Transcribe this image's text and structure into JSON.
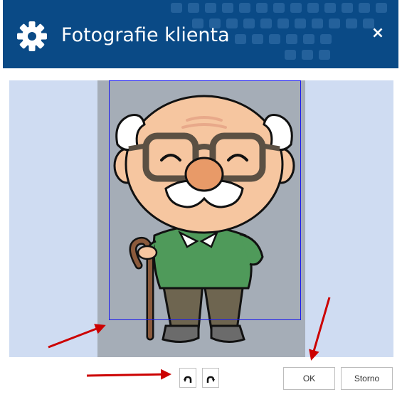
{
  "dialog": {
    "title": "Fotografie klienta",
    "close_label": "×",
    "header_icon": "gear-icon",
    "header_color": "#0a4a86"
  },
  "editor": {
    "background_color": "#cfdcf2",
    "photo_background": "#a5adb7",
    "crop_frame_color": "#1a1aee",
    "photo_subject": "cartoon-grandfather-with-cane"
  },
  "toolbar": {
    "rotate_left_icon": "rotate-left-icon",
    "rotate_right_icon": "rotate-right-icon"
  },
  "buttons": {
    "ok_label": "OK",
    "cancel_label": "Storno"
  },
  "annotations": {
    "arrow_color": "#cc0000"
  }
}
